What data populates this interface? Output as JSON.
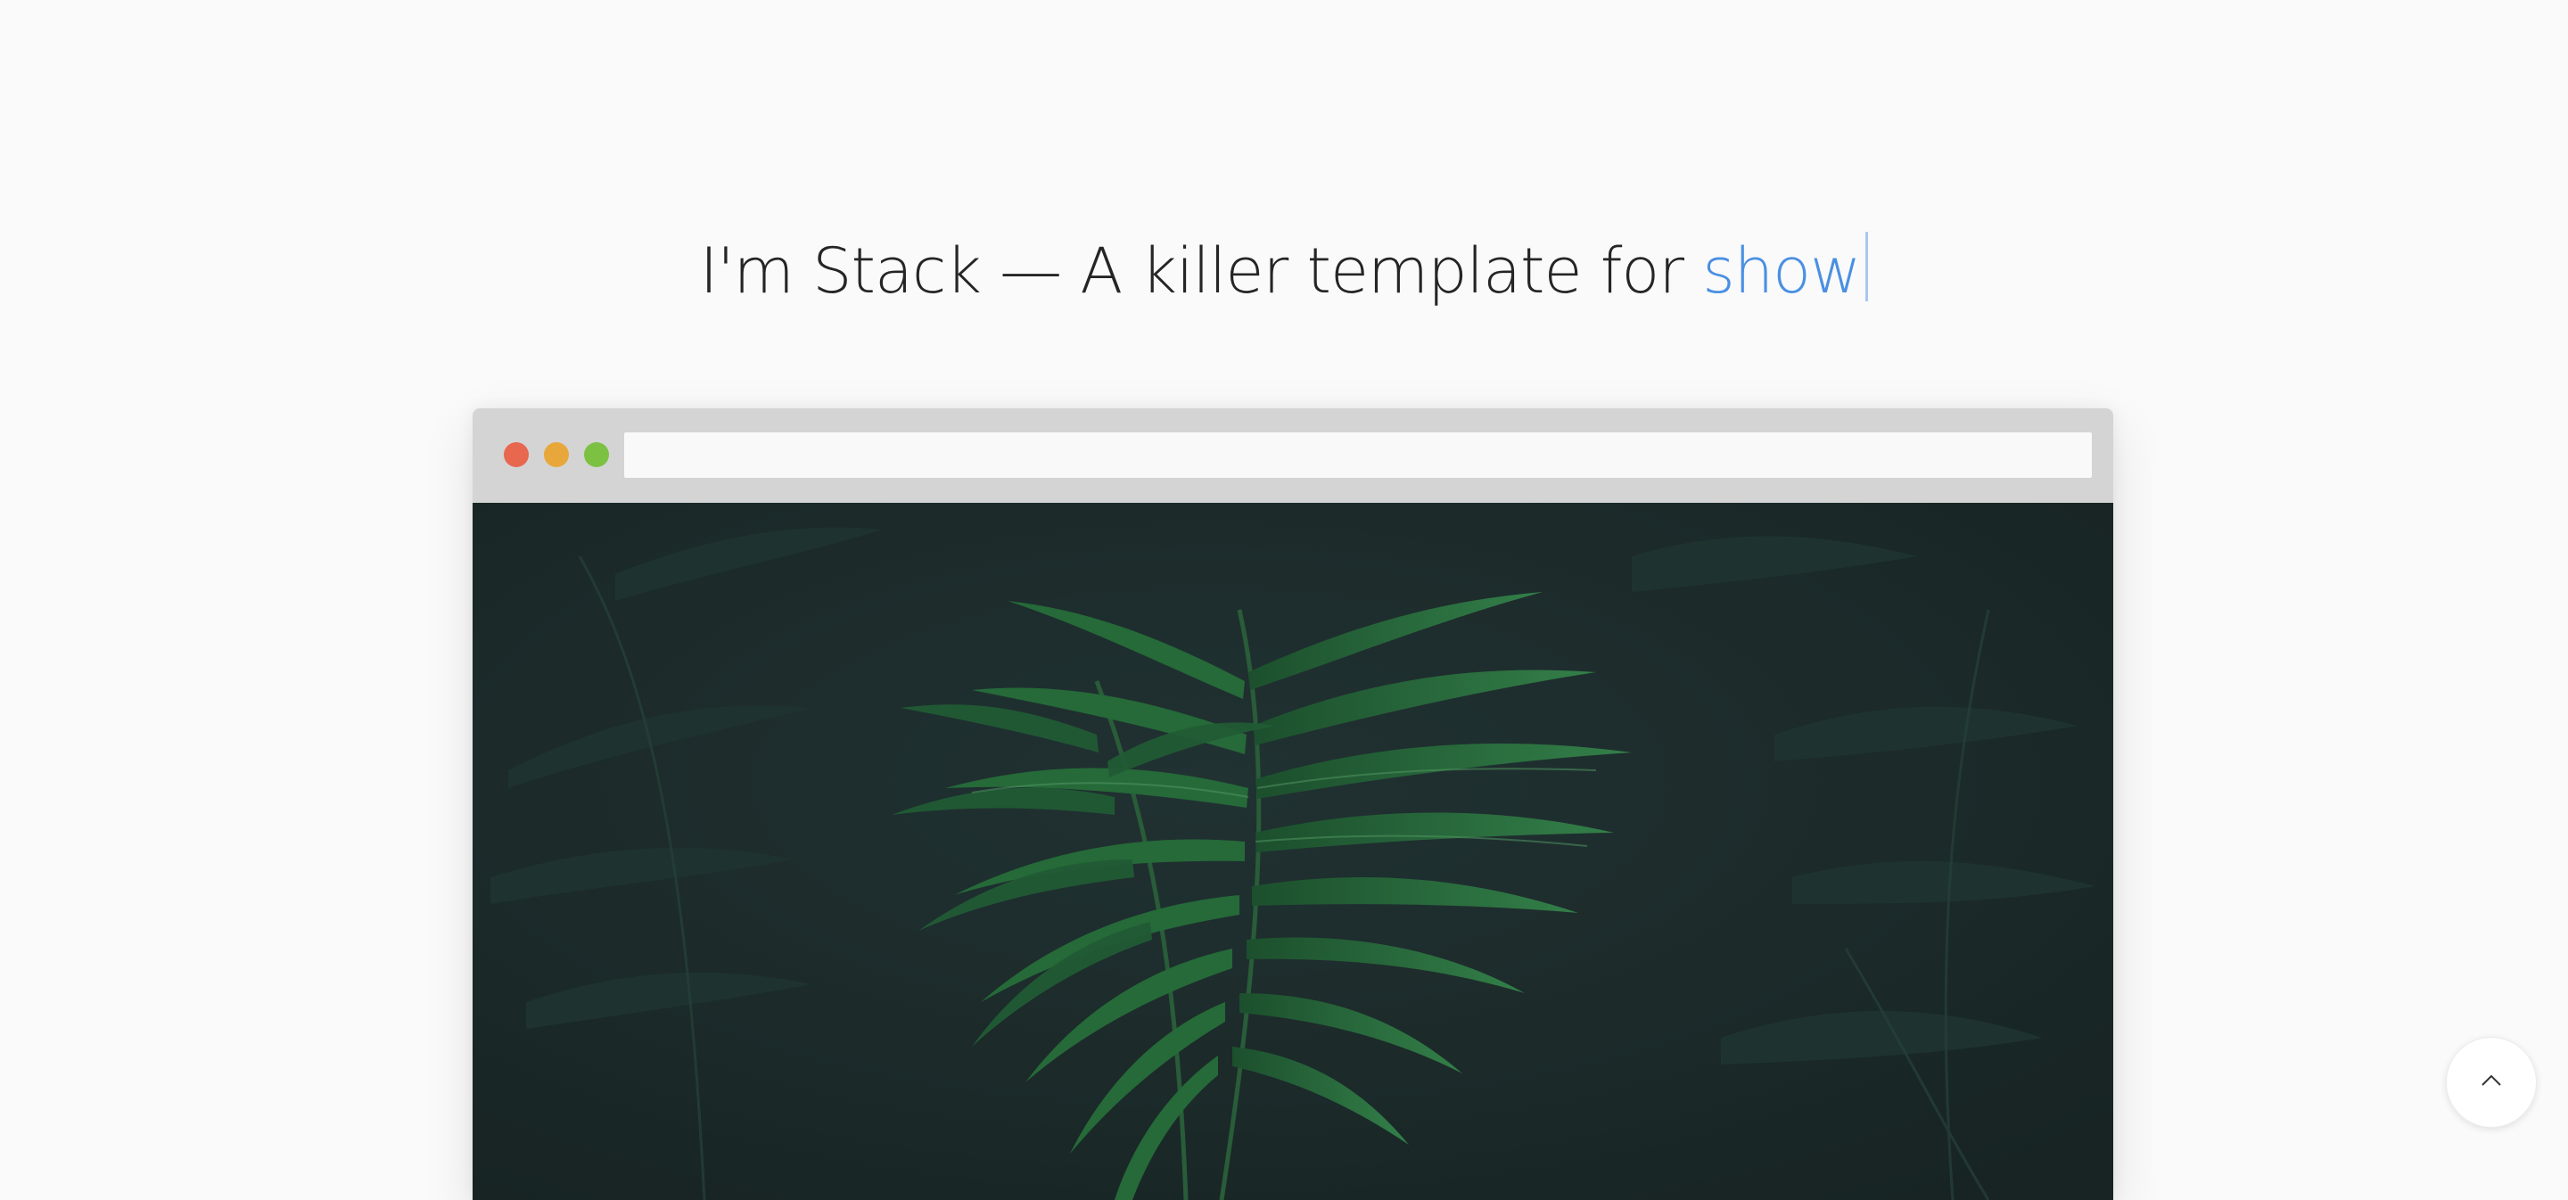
{
  "hero": {
    "headline_text": "I'm Stack — A killer template for ",
    "typed_word": "show"
  },
  "browser_mockup": {
    "address_text": "",
    "window_controls": [
      {
        "name": "close",
        "color": "#e8674f"
      },
      {
        "name": "minimize",
        "color": "#e8a73a"
      },
      {
        "name": "maximize",
        "color": "#7cc142"
      }
    ],
    "image": {
      "subject": "fern-leaves-image",
      "background_color": "#1f2c2c",
      "foliage_color": "#2e7d3e"
    }
  },
  "scroll_to_top": {
    "icon": "chevron-up-icon"
  },
  "colors": {
    "page_background": "#fafafa",
    "headline_text": "#252525",
    "accent": "#4a90e2",
    "browser_bar": "#d4d4d4"
  }
}
